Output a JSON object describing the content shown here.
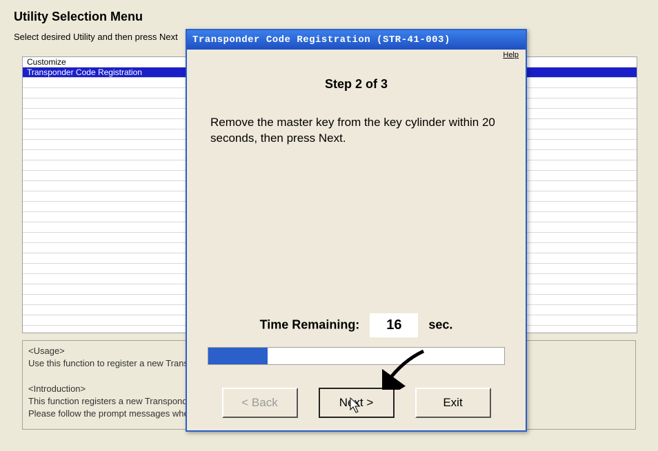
{
  "background": {
    "title": "Utility Selection Menu",
    "subtitle": "Select desired Utility and then press Next",
    "list_items": [
      {
        "label": "Customize",
        "selected": false
      },
      {
        "label": "Transponder Code Registration",
        "selected": true
      }
    ],
    "usage": {
      "usage_header": "<Usage>",
      "usage_line": "Use this function to register a new Transp",
      "intro_header": "<Introduction>",
      "intro_line1": "This function registers a new Transponde",
      "intro_line2": "Please follow the prompt messages when"
    }
  },
  "dialog": {
    "title": "Transponder Code Registration (STR-41-003)",
    "help_label": "Help",
    "step_heading": "Step 2 of 3",
    "instruction": "Remove the master key from the key cylinder within 20 seconds, then press Next.",
    "time_label": "Time Remaining:",
    "time_value": "16",
    "time_unit": "sec.",
    "progress_percent": 20,
    "buttons": {
      "back": "< Back",
      "next": "Next >",
      "exit": "Exit"
    }
  }
}
